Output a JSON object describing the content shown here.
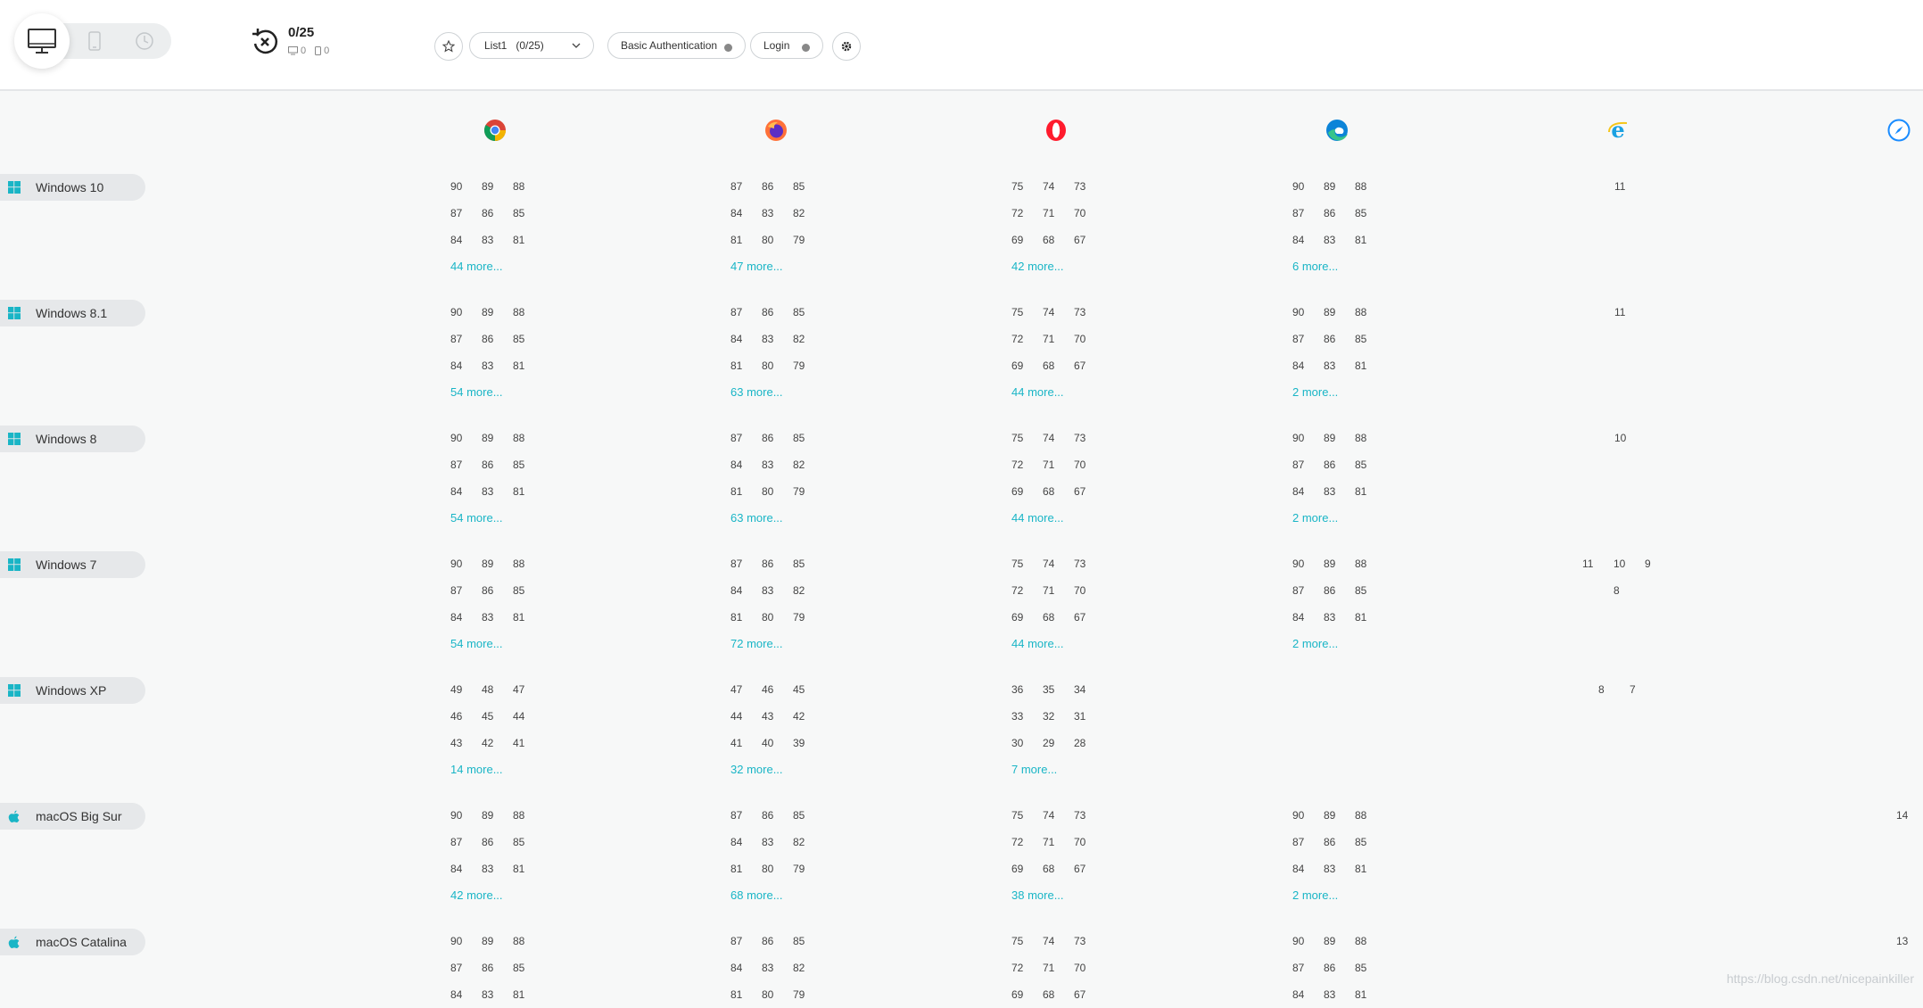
{
  "toolbar": {
    "counter_main": "0/25",
    "counter_desktop": "0",
    "counter_mobile": "0",
    "list_select": "List1   (0/25)",
    "basic_auth_label": "Basic Authentication",
    "login_label": "Login"
  },
  "browsers": [
    "chrome-icon",
    "firefox-icon",
    "opera-icon",
    "edge-icon",
    "ie-icon",
    "safari-icon"
  ],
  "colors": {
    "accent": "#19b5c6",
    "os_icon": "#19b5c6"
  },
  "rows": [
    {
      "os": "Windows 10",
      "icon": "windows-icon",
      "chrome": {
        "versions": [
          [
            "90",
            "89",
            "88"
          ],
          [
            "87",
            "86",
            "85"
          ],
          [
            "84",
            "83",
            "81"
          ]
        ],
        "more": "44 more..."
      },
      "firefox": {
        "versions": [
          [
            "87",
            "86",
            "85"
          ],
          [
            "84",
            "83",
            "82"
          ],
          [
            "81",
            "80",
            "79"
          ]
        ],
        "more": "47 more..."
      },
      "opera": {
        "versions": [
          [
            "75",
            "74",
            "73"
          ],
          [
            "72",
            "71",
            "70"
          ],
          [
            "69",
            "68",
            "67"
          ]
        ],
        "more": "42 more..."
      },
      "edge": {
        "versions": [
          [
            "90",
            "89",
            "88"
          ],
          [
            "87",
            "86",
            "85"
          ],
          [
            "84",
            "83",
            "81"
          ]
        ],
        "more": "6 more..."
      },
      "ie": {
        "versions": [
          [
            "11"
          ]
        ],
        "more": ""
      },
      "safari": {
        "versions": [],
        "more": ""
      }
    },
    {
      "os": "Windows 8.1",
      "icon": "windows-icon",
      "chrome": {
        "versions": [
          [
            "90",
            "89",
            "88"
          ],
          [
            "87",
            "86",
            "85"
          ],
          [
            "84",
            "83",
            "81"
          ]
        ],
        "more": "54 more..."
      },
      "firefox": {
        "versions": [
          [
            "87",
            "86",
            "85"
          ],
          [
            "84",
            "83",
            "82"
          ],
          [
            "81",
            "80",
            "79"
          ]
        ],
        "more": "63 more..."
      },
      "opera": {
        "versions": [
          [
            "75",
            "74",
            "73"
          ],
          [
            "72",
            "71",
            "70"
          ],
          [
            "69",
            "68",
            "67"
          ]
        ],
        "more": "44 more..."
      },
      "edge": {
        "versions": [
          [
            "90",
            "89",
            "88"
          ],
          [
            "87",
            "86",
            "85"
          ],
          [
            "84",
            "83",
            "81"
          ]
        ],
        "more": "2 more..."
      },
      "ie": {
        "versions": [
          [
            "11"
          ]
        ],
        "more": ""
      },
      "safari": {
        "versions": [],
        "more": ""
      }
    },
    {
      "os": "Windows 8",
      "icon": "windows-icon",
      "chrome": {
        "versions": [
          [
            "90",
            "89",
            "88"
          ],
          [
            "87",
            "86",
            "85"
          ],
          [
            "84",
            "83",
            "81"
          ]
        ],
        "more": "54 more..."
      },
      "firefox": {
        "versions": [
          [
            "87",
            "86",
            "85"
          ],
          [
            "84",
            "83",
            "82"
          ],
          [
            "81",
            "80",
            "79"
          ]
        ],
        "more": "63 more..."
      },
      "opera": {
        "versions": [
          [
            "75",
            "74",
            "73"
          ],
          [
            "72",
            "71",
            "70"
          ],
          [
            "69",
            "68",
            "67"
          ]
        ],
        "more": "44 more..."
      },
      "edge": {
        "versions": [
          [
            "90",
            "89",
            "88"
          ],
          [
            "87",
            "86",
            "85"
          ],
          [
            "84",
            "83",
            "81"
          ]
        ],
        "more": "2 more..."
      },
      "ie": {
        "versions": [
          [
            "10"
          ]
        ],
        "more": ""
      },
      "safari": {
        "versions": [],
        "more": ""
      }
    },
    {
      "os": "Windows 7",
      "icon": "windows-icon",
      "chrome": {
        "versions": [
          [
            "90",
            "89",
            "88"
          ],
          [
            "87",
            "86",
            "85"
          ],
          [
            "84",
            "83",
            "81"
          ]
        ],
        "more": "54 more..."
      },
      "firefox": {
        "versions": [
          [
            "87",
            "86",
            "85"
          ],
          [
            "84",
            "83",
            "82"
          ],
          [
            "81",
            "80",
            "79"
          ]
        ],
        "more": "72 more..."
      },
      "opera": {
        "versions": [
          [
            "75",
            "74",
            "73"
          ],
          [
            "72",
            "71",
            "70"
          ],
          [
            "69",
            "68",
            "67"
          ]
        ],
        "more": "44 more..."
      },
      "edge": {
        "versions": [
          [
            "90",
            "89",
            "88"
          ],
          [
            "87",
            "86",
            "85"
          ],
          [
            "84",
            "83",
            "81"
          ]
        ],
        "more": "2 more..."
      },
      "ie": {
        "versions": [
          [
            "11",
            "10",
            "9"
          ],
          [
            "",
            "8",
            ""
          ]
        ],
        "more": ""
      },
      "safari": {
        "versions": [],
        "more": ""
      }
    },
    {
      "os": "Windows XP",
      "icon": "windows-icon",
      "chrome": {
        "versions": [
          [
            "49",
            "48",
            "47"
          ],
          [
            "46",
            "45",
            "44"
          ],
          [
            "43",
            "42",
            "41"
          ]
        ],
        "more": "14 more..."
      },
      "firefox": {
        "versions": [
          [
            "47",
            "46",
            "45"
          ],
          [
            "44",
            "43",
            "42"
          ],
          [
            "41",
            "40",
            "39"
          ]
        ],
        "more": "32 more..."
      },
      "opera": {
        "versions": [
          [
            "36",
            "35",
            "34"
          ],
          [
            "33",
            "32",
            "31"
          ],
          [
            "30",
            "29",
            "28"
          ]
        ],
        "more": "7 more..."
      },
      "edge": {
        "versions": [],
        "more": ""
      },
      "ie": {
        "versions": [
          [
            "8",
            "7"
          ]
        ],
        "more": ""
      },
      "safari": {
        "versions": [],
        "more": ""
      }
    },
    {
      "os": "macOS Big Sur",
      "icon": "apple-icon",
      "chrome": {
        "versions": [
          [
            "90",
            "89",
            "88"
          ],
          [
            "87",
            "86",
            "85"
          ],
          [
            "84",
            "83",
            "81"
          ]
        ],
        "more": "42 more..."
      },
      "firefox": {
        "versions": [
          [
            "87",
            "86",
            "85"
          ],
          [
            "84",
            "83",
            "82"
          ],
          [
            "81",
            "80",
            "79"
          ]
        ],
        "more": "68 more..."
      },
      "opera": {
        "versions": [
          [
            "75",
            "74",
            "73"
          ],
          [
            "72",
            "71",
            "70"
          ],
          [
            "69",
            "68",
            "67"
          ]
        ],
        "more": "38 more..."
      },
      "edge": {
        "versions": [
          [
            "90",
            "89",
            "88"
          ],
          [
            "87",
            "86",
            "85"
          ],
          [
            "84",
            "83",
            "81"
          ]
        ],
        "more": "2 more..."
      },
      "ie": {
        "versions": [],
        "more": ""
      },
      "safari": {
        "versions": [
          [
            "14"
          ]
        ],
        "more": ""
      }
    },
    {
      "os": "macOS Catalina",
      "icon": "apple-icon",
      "chrome": {
        "versions": [
          [
            "90",
            "89",
            "88"
          ],
          [
            "87",
            "86",
            "85"
          ],
          [
            "84",
            "83",
            "81"
          ]
        ],
        "more": ""
      },
      "firefox": {
        "versions": [
          [
            "87",
            "86",
            "85"
          ],
          [
            "84",
            "83",
            "82"
          ],
          [
            "81",
            "80",
            "79"
          ]
        ],
        "more": ""
      },
      "opera": {
        "versions": [
          [
            "75",
            "74",
            "73"
          ],
          [
            "72",
            "71",
            "70"
          ],
          [
            "69",
            "68",
            "67"
          ]
        ],
        "more": ""
      },
      "edge": {
        "versions": [
          [
            "90",
            "89",
            "88"
          ],
          [
            "87",
            "86",
            "85"
          ],
          [
            "84",
            "83",
            "81"
          ]
        ],
        "more": ""
      },
      "ie": {
        "versions": [],
        "more": ""
      },
      "safari": {
        "versions": [
          [
            "13"
          ]
        ],
        "more": ""
      }
    }
  ],
  "watermark": "https://blog.csdn.net/nicepainkiller"
}
